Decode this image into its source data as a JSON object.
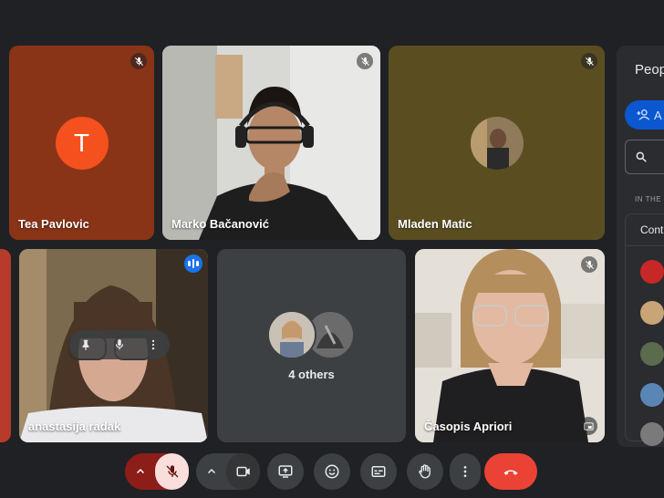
{
  "tiles": {
    "tea": {
      "name": "Tea Pavlovic",
      "initial": "T",
      "muted": true
    },
    "marko": {
      "name": "Marko Bačanović",
      "muted": true
    },
    "mladen": {
      "name": "Mladen Matic",
      "muted": true
    },
    "anastasija": {
      "name": "anastasija radak",
      "speaking": true
    },
    "others": {
      "label": "4 others"
    },
    "casopis": {
      "name": "Časopis Apriori",
      "muted": true
    }
  },
  "people_panel": {
    "title": "Peop",
    "add_label": "A",
    "section_label": "IN THE M",
    "group_label": "Cont"
  },
  "controls": {
    "mic_muted": true,
    "camera_on": true,
    "end_call_color": "#ea4335"
  },
  "colors": {
    "background": "#202124",
    "tea_tile": "#8a3417",
    "tea_avatar": "#f4511e",
    "speaking_border": "#a8c7fa",
    "accent_blue": "#0b57d0"
  }
}
